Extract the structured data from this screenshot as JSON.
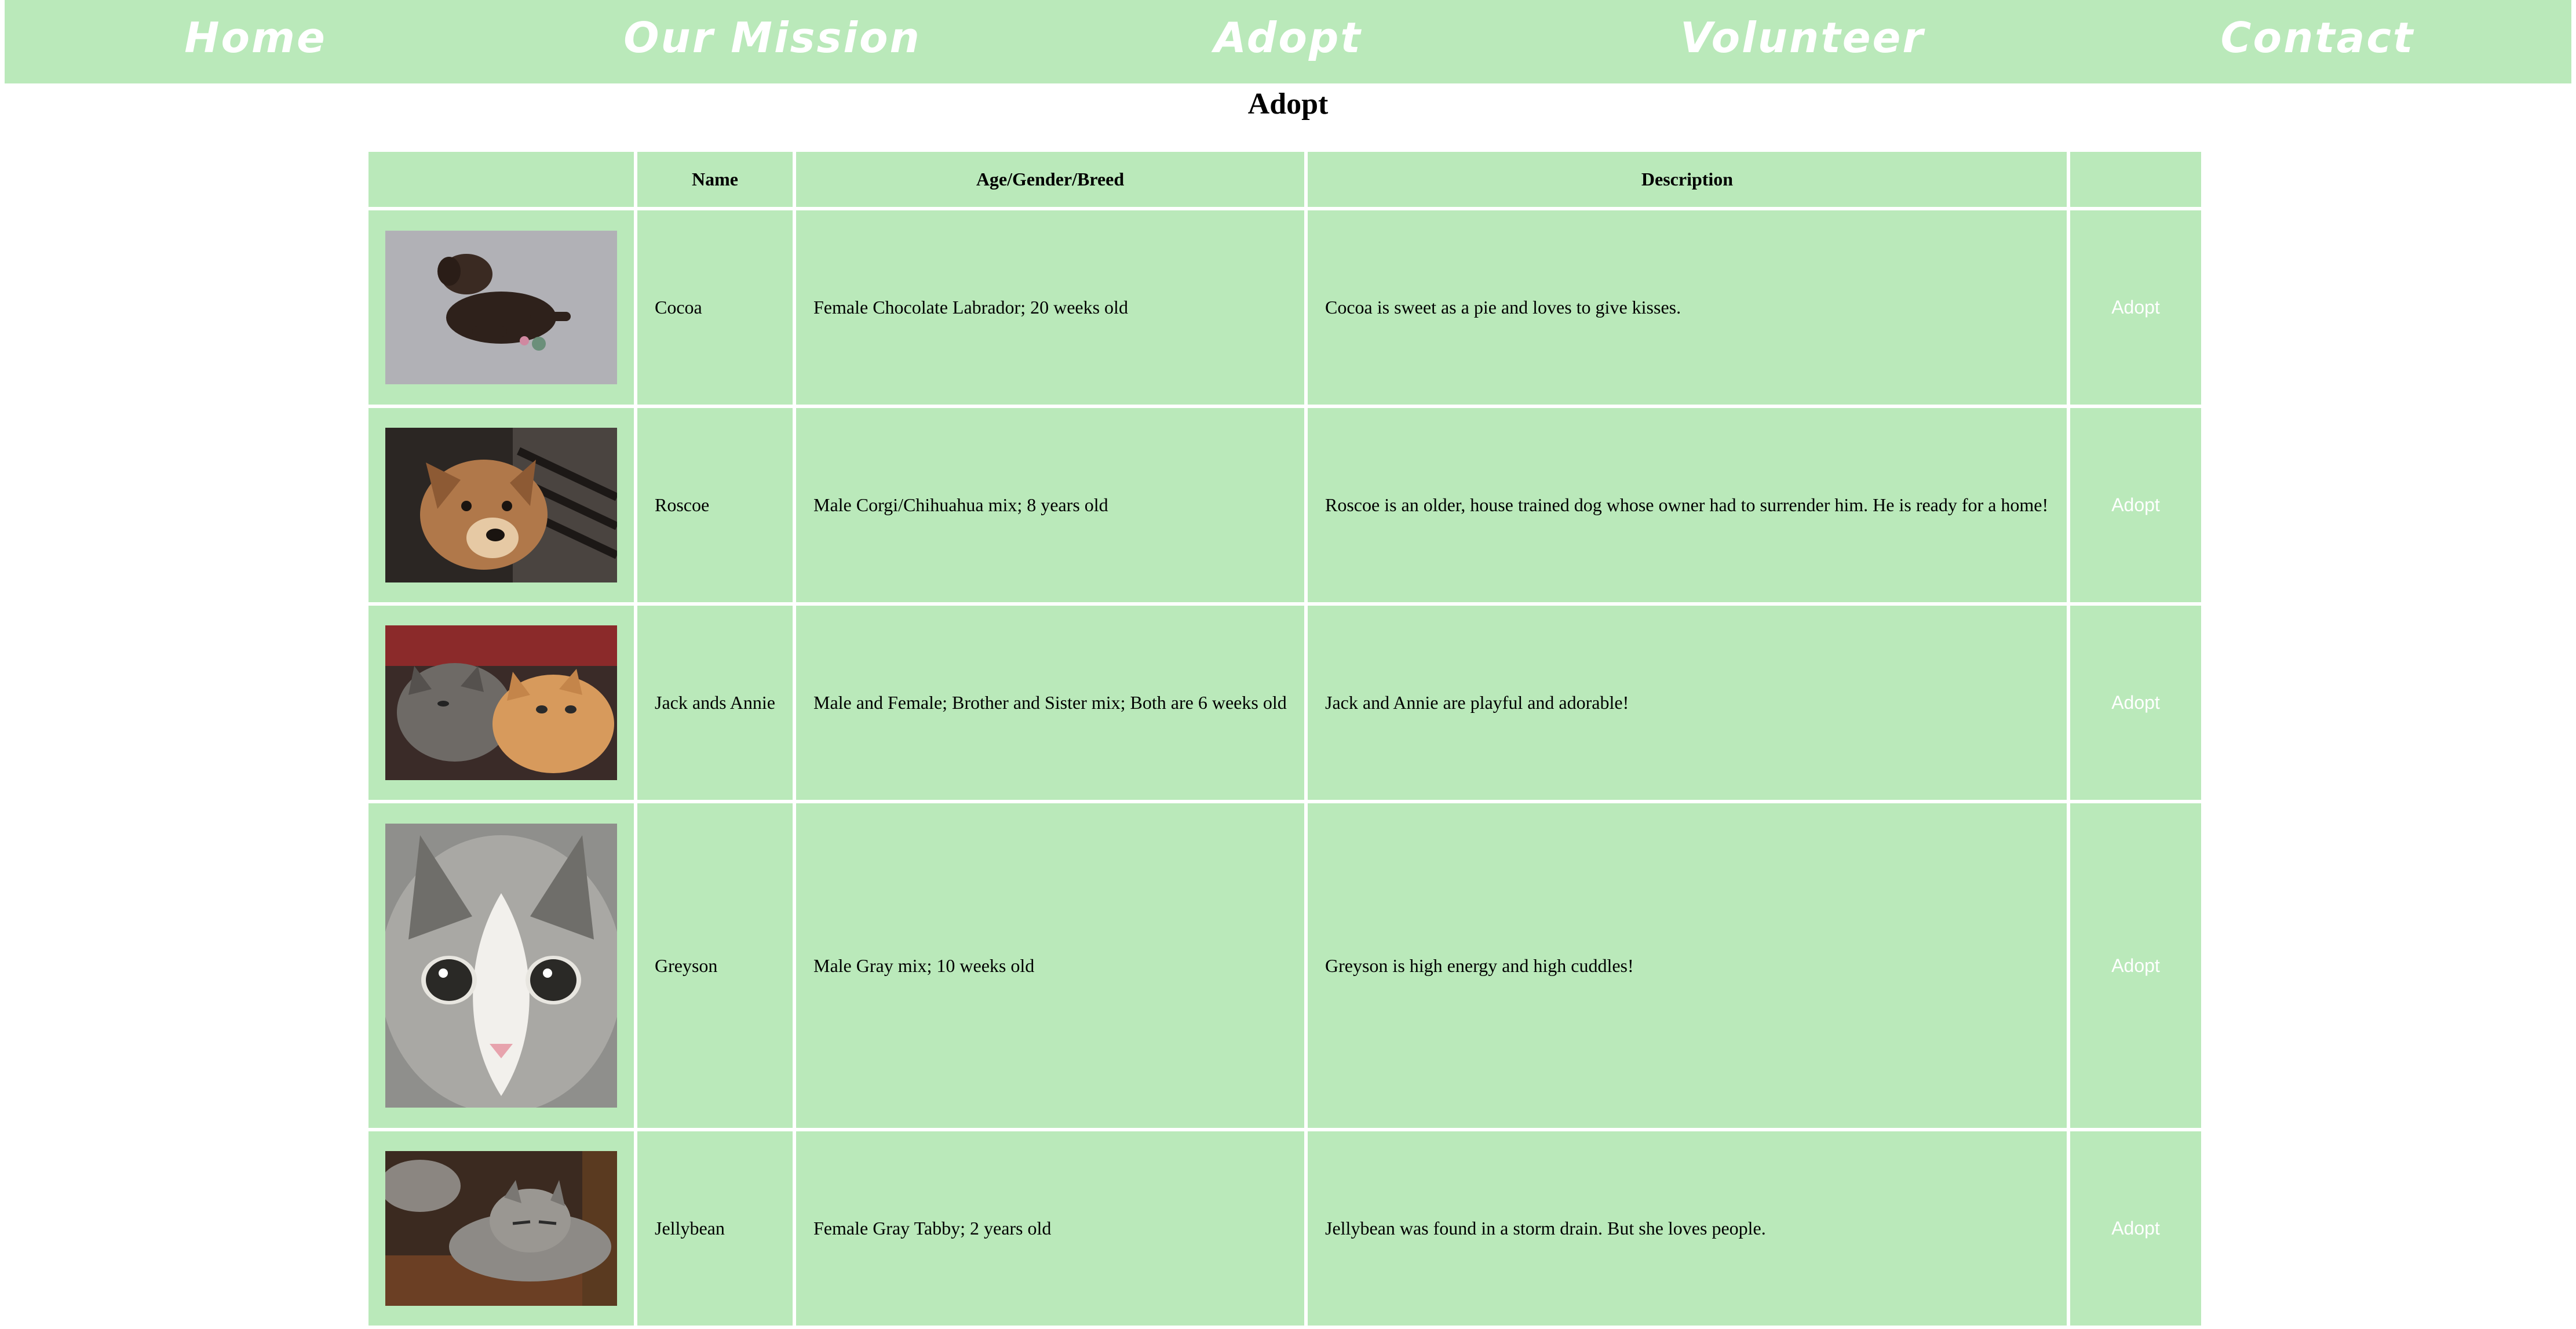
{
  "nav": {
    "items": [
      {
        "label": "Home"
      },
      {
        "label": "Our Mission"
      },
      {
        "label": "Adopt"
      },
      {
        "label": "Volunteer"
      },
      {
        "label": "Contact"
      }
    ]
  },
  "page": {
    "title": "Adopt"
  },
  "table": {
    "headers": [
      "",
      "Name",
      "Age/Gender/Breed",
      "Description",
      ""
    ],
    "rows": [
      {
        "photo": "chocolate-labrador-puppy-photo",
        "name": "Cocoa",
        "details": "Female Chocolate Labrador; 20 weeks old",
        "description": "Cocoa is sweet as a pie and loves to give kisses.",
        "action": "Adopt"
      },
      {
        "photo": "corgi-chihuahua-dog-photo",
        "name": "Roscoe",
        "details": "Male Corgi/Chihuahua mix; 8 years old",
        "description": "Roscoe is an older, house trained dog whose owner had to surrender him. He is ready for a home!",
        "action": "Adopt"
      },
      {
        "photo": "two-kittens-photo",
        "name": "Jack ands Annie",
        "details": "Male and Female; Brother and Sister mix; Both are 6 weeks old",
        "description": "Jack and Annie are playful and adorable!",
        "action": "Adopt"
      },
      {
        "photo": "gray-kitten-face-photo",
        "name": "Greyson",
        "details": "Male Gray mix; 10 weeks old",
        "description": "Greyson is high energy and high cuddles!",
        "action": "Adopt"
      },
      {
        "photo": "gray-tabby-cat-photo",
        "name": "Jellybean",
        "details": "Female Gray Tabby; 2 years old",
        "description": "Jellybean was found in a storm drain. But she loves people.",
        "action": "Adopt"
      }
    ]
  },
  "colors": {
    "accent": "#bae9ba",
    "link_text": "#ffffff"
  }
}
